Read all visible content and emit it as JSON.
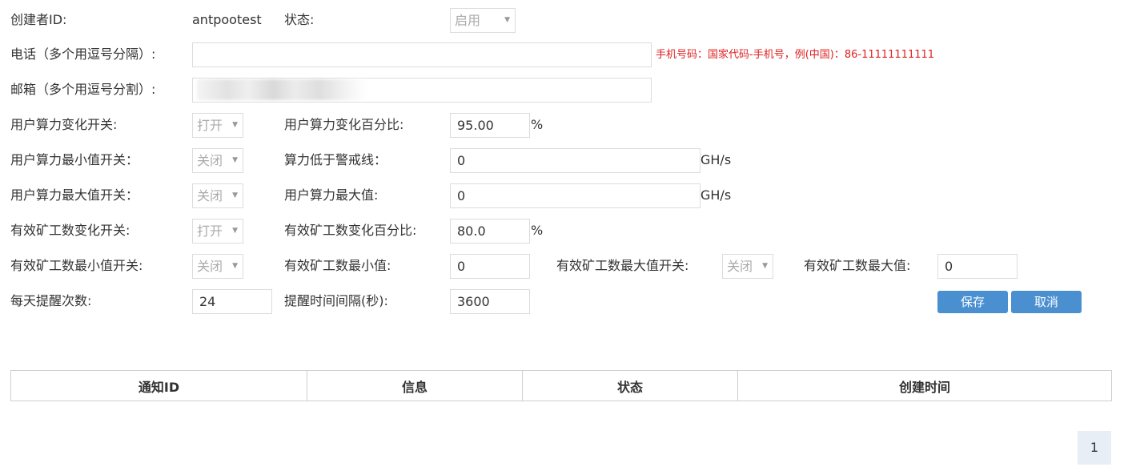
{
  "creator": {
    "label": "创建者ID:",
    "value": "antpootest"
  },
  "status": {
    "label": "状态:",
    "selected": "启用"
  },
  "phone": {
    "label": "电话（多个用逗号分隔）:",
    "value": "",
    "hint": "手机号码：国家代码-手机号，例(中国)：86-11111111111"
  },
  "email": {
    "label": "邮箱（多个用逗号分割）:",
    "value": ""
  },
  "rows": {
    "r1": {
      "switch_label": "用户算力变化开关:",
      "switch_value": "打开",
      "field_label": "用户算力变化百分比:",
      "field_value": "95.00",
      "unit": "%"
    },
    "r2": {
      "switch_label": "用户算力最小值开关：",
      "switch_value": "关闭",
      "field_label": "算力低于警戒线：",
      "field_value": "0",
      "unit": "GH/s"
    },
    "r3": {
      "switch_label": "用户算力最大值开关：",
      "switch_value": "关闭",
      "field_label": "用户算力最大值:",
      "field_value": "0",
      "unit": "GH/s"
    },
    "r4": {
      "switch_label": "有效矿工数变化开关:",
      "switch_value": "打开",
      "field_label": "有效矿工数变化百分比:",
      "field_value": "80.0",
      "unit": "%"
    },
    "r5": {
      "switch_label": "有效矿工数最小值开关:",
      "switch_value": "关闭",
      "field_label": "有效矿工数最小值:",
      "field_value": "0",
      "max_switch_label": "有效矿工数最大值开关:",
      "max_switch_value": "关闭",
      "max_label": "有效矿工数最大值:",
      "max_value": "0"
    },
    "r6": {
      "daily_label": "每天提醒次数:",
      "daily_value": "24",
      "interval_label": "提醒时间间隔(秒):",
      "interval_value": "3600"
    }
  },
  "buttons": {
    "save": "保存",
    "cancel": "取消"
  },
  "table": {
    "headers": [
      "通知ID",
      "信息",
      "状态",
      "创建时间"
    ]
  },
  "pagination": {
    "current": "1"
  },
  "colors": {
    "accent": "#4a8fd0",
    "hint": "#e02020"
  }
}
